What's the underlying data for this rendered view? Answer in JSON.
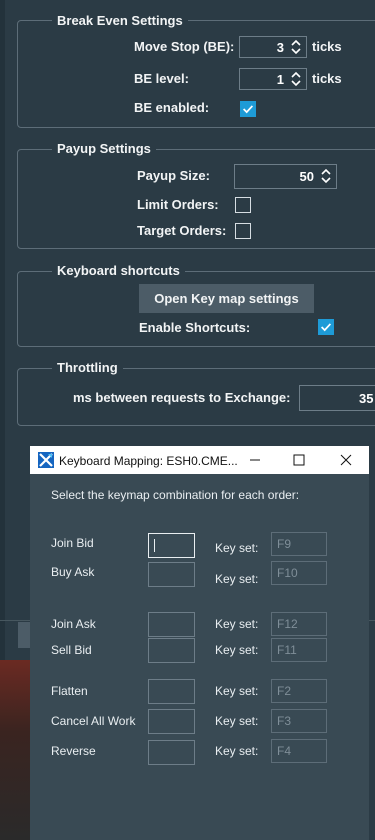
{
  "break_even": {
    "legend": "Break Even Settings",
    "move_stop_label": "Move Stop (BE):",
    "move_stop_value": "3",
    "move_stop_unit": "ticks",
    "be_level_label": "BE level:",
    "be_level_value": "1",
    "be_level_unit": "ticks",
    "be_enabled_label": "BE enabled:",
    "be_enabled_checked": true
  },
  "payup": {
    "legend": "Payup Settings",
    "size_label": "Payup Size:",
    "size_value": "50",
    "limit_label": "Limit Orders:",
    "limit_checked": false,
    "target_label": "Target Orders:",
    "target_checked": false
  },
  "keyboard": {
    "legend": "Keyboard shortcuts",
    "open_button": "Open Key map settings",
    "enable_label": "Enable Shortcuts:",
    "enable_checked": true
  },
  "throttling": {
    "legend": "Throttling",
    "ms_label": "ms between requests to Exchange:",
    "ms_value": "35"
  },
  "dialog": {
    "title": "Keyboard Mapping: ESH0.CME...",
    "instruction": "Select the keymap combination for each order:",
    "key_set_label": "Key set:",
    "rows": [
      {
        "label": "Join Bid",
        "key": "F9"
      },
      {
        "label": "Buy Ask",
        "key": "F10"
      },
      {
        "label": "Join Ask",
        "key": "F12"
      },
      {
        "label": "Sell Bid",
        "key": "F11"
      },
      {
        "label": "Flatten",
        "key": "F2"
      },
      {
        "label": "Cancel All Work",
        "key": "F3"
      },
      {
        "label": "Reverse",
        "key": "F4"
      }
    ]
  },
  "colors": {
    "background": "#2b3b45",
    "dialog_background": "#394a54",
    "checkbox_on": "#1e9bd7",
    "button": "#4c5c67"
  }
}
